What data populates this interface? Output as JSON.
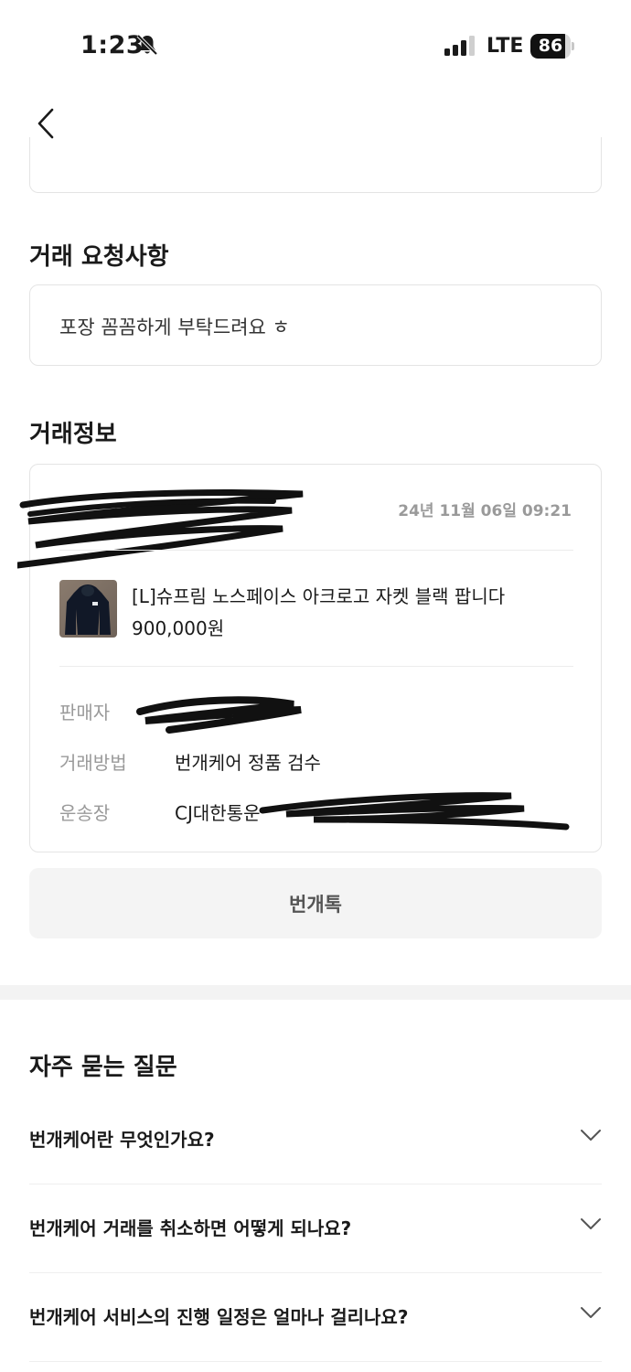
{
  "status_bar": {
    "time": "1:23",
    "network": "LTE",
    "battery": "86",
    "battery_level": 0.86
  },
  "request_section": {
    "title": "거래 요청사항",
    "text": "포장 꼼꼼하게 부탁드려요 ㅎ"
  },
  "info_section": {
    "title": "거래정보",
    "date": "24년 11월 06일 09:21",
    "product": {
      "title": "[L]슈프림 노스페이스 아크로고 자켓 블랙 팝니다",
      "price": "900,000원"
    },
    "rows": [
      {
        "label": "판매자",
        "value": ""
      },
      {
        "label": "거래방법",
        "value": "번개케어 정품 검수"
      },
      {
        "label": "운송장",
        "value": "CJ대한통운"
      }
    ],
    "chat_button": "번개톡"
  },
  "faq_section": {
    "title": "자주 묻는 질문",
    "items": [
      {
        "question": "번개케어란 무엇인가요?"
      },
      {
        "question": "번개케어 거래를 취소하면 어떻게 되나요?"
      },
      {
        "question": "번개케어 서비스의 진행 일정은 얼마나 걸리나요?"
      }
    ]
  },
  "colors": {
    "border": "#e4e4e4",
    "muted_text": "#9a9a9a",
    "button_bg": "#f4f4f4"
  }
}
